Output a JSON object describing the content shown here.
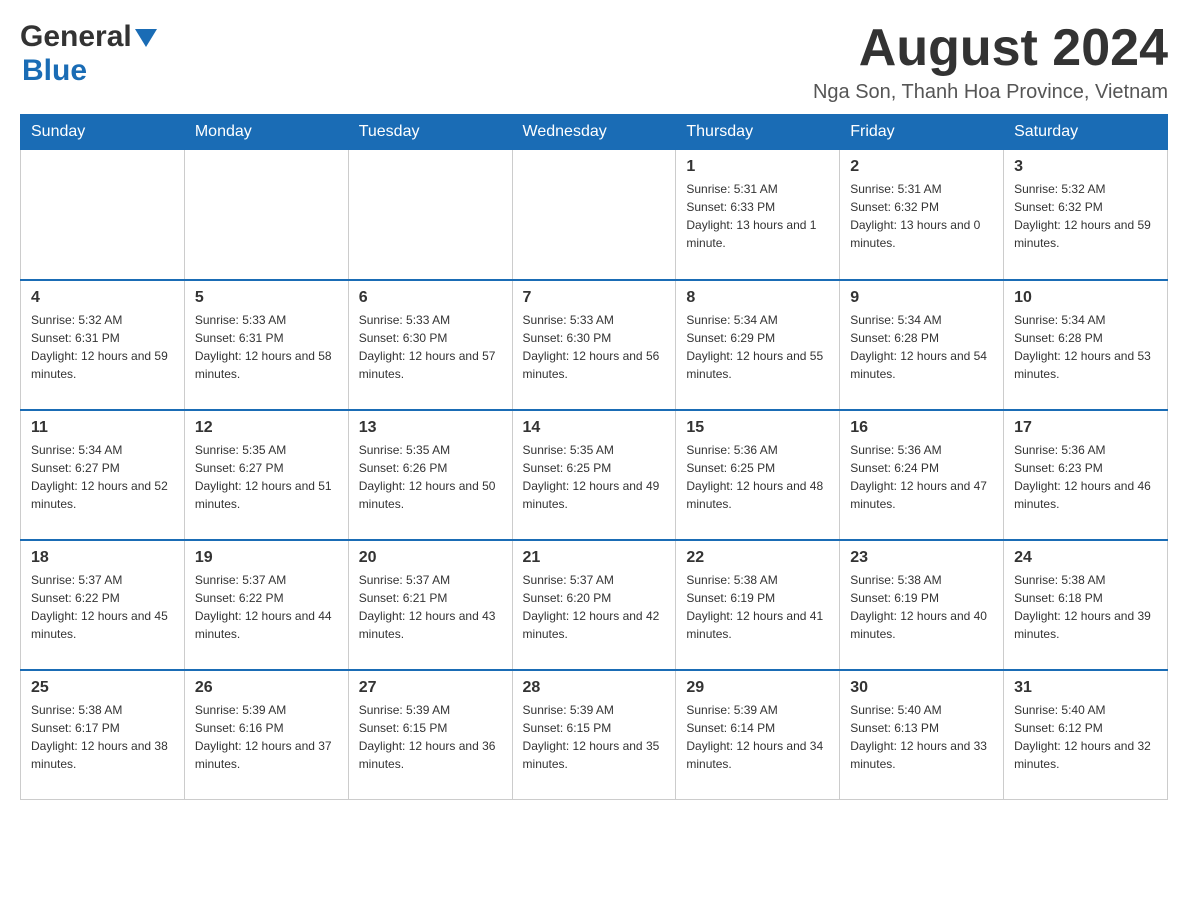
{
  "header": {
    "logo_text1": "General",
    "logo_text2": "Blue",
    "month_title": "August 2024",
    "location": "Nga Son, Thanh Hoa Province, Vietnam"
  },
  "days_of_week": [
    "Sunday",
    "Monday",
    "Tuesday",
    "Wednesday",
    "Thursday",
    "Friday",
    "Saturday"
  ],
  "weeks": [
    {
      "days": [
        {
          "date": "",
          "info": ""
        },
        {
          "date": "",
          "info": ""
        },
        {
          "date": "",
          "info": ""
        },
        {
          "date": "",
          "info": ""
        },
        {
          "date": "1",
          "info": "Sunrise: 5:31 AM\nSunset: 6:33 PM\nDaylight: 13 hours and 1 minute."
        },
        {
          "date": "2",
          "info": "Sunrise: 5:31 AM\nSunset: 6:32 PM\nDaylight: 13 hours and 0 minutes."
        },
        {
          "date": "3",
          "info": "Sunrise: 5:32 AM\nSunset: 6:32 PM\nDaylight: 12 hours and 59 minutes."
        }
      ]
    },
    {
      "days": [
        {
          "date": "4",
          "info": "Sunrise: 5:32 AM\nSunset: 6:31 PM\nDaylight: 12 hours and 59 minutes."
        },
        {
          "date": "5",
          "info": "Sunrise: 5:33 AM\nSunset: 6:31 PM\nDaylight: 12 hours and 58 minutes."
        },
        {
          "date": "6",
          "info": "Sunrise: 5:33 AM\nSunset: 6:30 PM\nDaylight: 12 hours and 57 minutes."
        },
        {
          "date": "7",
          "info": "Sunrise: 5:33 AM\nSunset: 6:30 PM\nDaylight: 12 hours and 56 minutes."
        },
        {
          "date": "8",
          "info": "Sunrise: 5:34 AM\nSunset: 6:29 PM\nDaylight: 12 hours and 55 minutes."
        },
        {
          "date": "9",
          "info": "Sunrise: 5:34 AM\nSunset: 6:28 PM\nDaylight: 12 hours and 54 minutes."
        },
        {
          "date": "10",
          "info": "Sunrise: 5:34 AM\nSunset: 6:28 PM\nDaylight: 12 hours and 53 minutes."
        }
      ]
    },
    {
      "days": [
        {
          "date": "11",
          "info": "Sunrise: 5:34 AM\nSunset: 6:27 PM\nDaylight: 12 hours and 52 minutes."
        },
        {
          "date": "12",
          "info": "Sunrise: 5:35 AM\nSunset: 6:27 PM\nDaylight: 12 hours and 51 minutes."
        },
        {
          "date": "13",
          "info": "Sunrise: 5:35 AM\nSunset: 6:26 PM\nDaylight: 12 hours and 50 minutes."
        },
        {
          "date": "14",
          "info": "Sunrise: 5:35 AM\nSunset: 6:25 PM\nDaylight: 12 hours and 49 minutes."
        },
        {
          "date": "15",
          "info": "Sunrise: 5:36 AM\nSunset: 6:25 PM\nDaylight: 12 hours and 48 minutes."
        },
        {
          "date": "16",
          "info": "Sunrise: 5:36 AM\nSunset: 6:24 PM\nDaylight: 12 hours and 47 minutes."
        },
        {
          "date": "17",
          "info": "Sunrise: 5:36 AM\nSunset: 6:23 PM\nDaylight: 12 hours and 46 minutes."
        }
      ]
    },
    {
      "days": [
        {
          "date": "18",
          "info": "Sunrise: 5:37 AM\nSunset: 6:22 PM\nDaylight: 12 hours and 45 minutes."
        },
        {
          "date": "19",
          "info": "Sunrise: 5:37 AM\nSunset: 6:22 PM\nDaylight: 12 hours and 44 minutes."
        },
        {
          "date": "20",
          "info": "Sunrise: 5:37 AM\nSunset: 6:21 PM\nDaylight: 12 hours and 43 minutes."
        },
        {
          "date": "21",
          "info": "Sunrise: 5:37 AM\nSunset: 6:20 PM\nDaylight: 12 hours and 42 minutes."
        },
        {
          "date": "22",
          "info": "Sunrise: 5:38 AM\nSunset: 6:19 PM\nDaylight: 12 hours and 41 minutes."
        },
        {
          "date": "23",
          "info": "Sunrise: 5:38 AM\nSunset: 6:19 PM\nDaylight: 12 hours and 40 minutes."
        },
        {
          "date": "24",
          "info": "Sunrise: 5:38 AM\nSunset: 6:18 PM\nDaylight: 12 hours and 39 minutes."
        }
      ]
    },
    {
      "days": [
        {
          "date": "25",
          "info": "Sunrise: 5:38 AM\nSunset: 6:17 PM\nDaylight: 12 hours and 38 minutes."
        },
        {
          "date": "26",
          "info": "Sunrise: 5:39 AM\nSunset: 6:16 PM\nDaylight: 12 hours and 37 minutes."
        },
        {
          "date": "27",
          "info": "Sunrise: 5:39 AM\nSunset: 6:15 PM\nDaylight: 12 hours and 36 minutes."
        },
        {
          "date": "28",
          "info": "Sunrise: 5:39 AM\nSunset: 6:15 PM\nDaylight: 12 hours and 35 minutes."
        },
        {
          "date": "29",
          "info": "Sunrise: 5:39 AM\nSunset: 6:14 PM\nDaylight: 12 hours and 34 minutes."
        },
        {
          "date": "30",
          "info": "Sunrise: 5:40 AM\nSunset: 6:13 PM\nDaylight: 12 hours and 33 minutes."
        },
        {
          "date": "31",
          "info": "Sunrise: 5:40 AM\nSunset: 6:12 PM\nDaylight: 12 hours and 32 minutes."
        }
      ]
    }
  ]
}
